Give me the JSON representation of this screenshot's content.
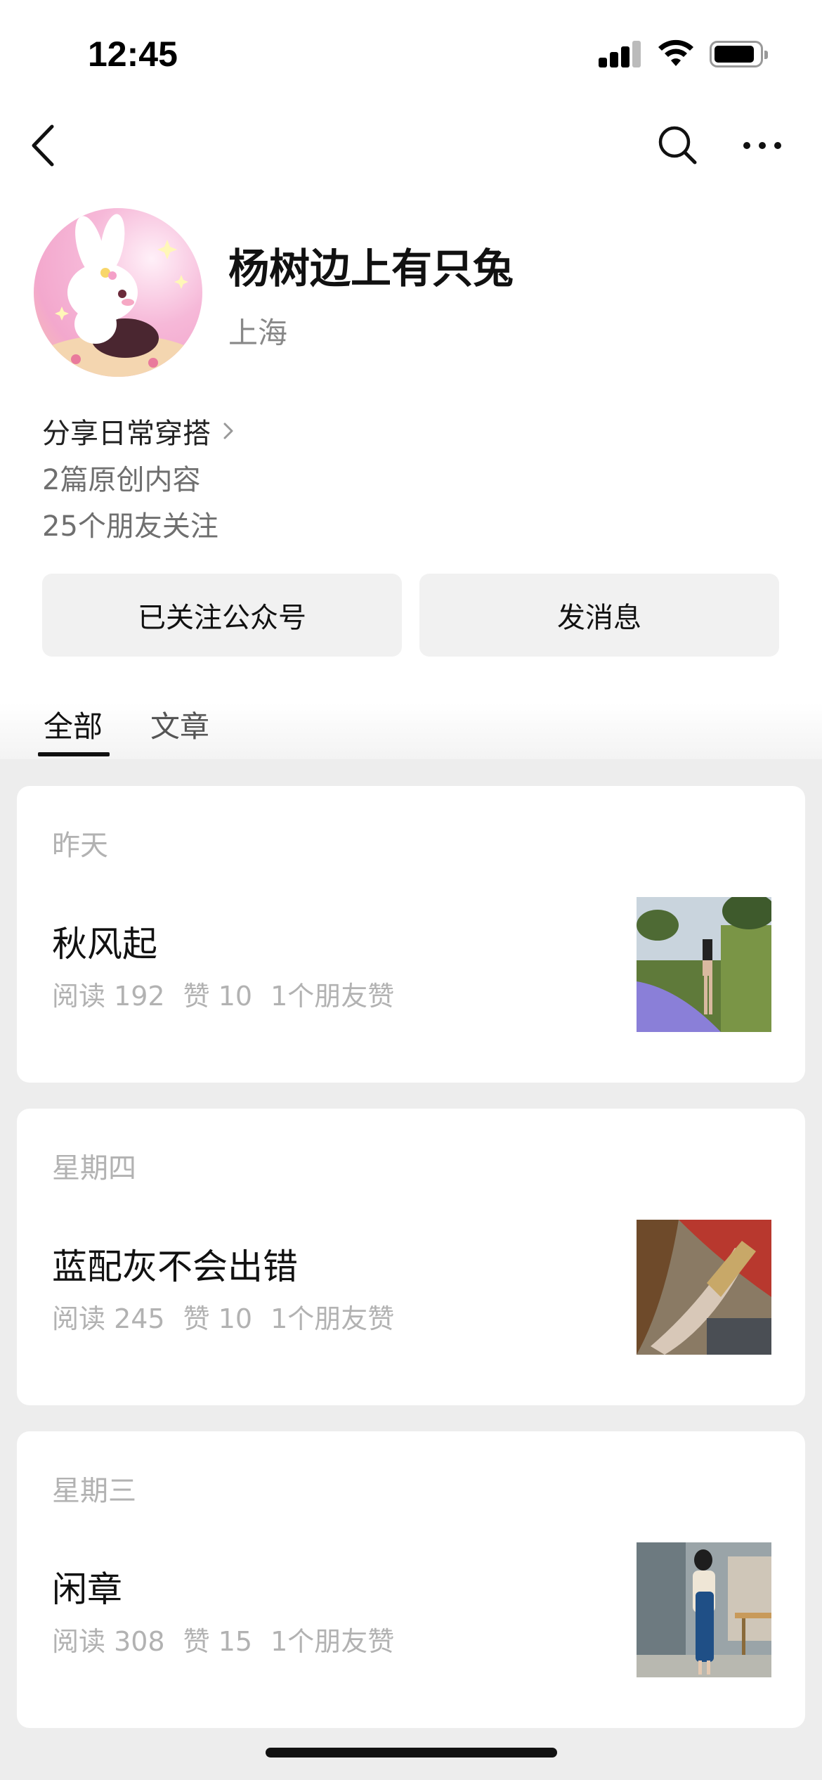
{
  "status_bar": {
    "time": "12:45"
  },
  "profile": {
    "name": "杨树边上有只兔",
    "location": "上海",
    "description": "分享日常穿搭",
    "original_count": "2篇原创内容",
    "friends_following": "25个朋友关注"
  },
  "actions": {
    "followed_label": "已关注公众号",
    "message_label": "发消息"
  },
  "tabs": [
    {
      "label": "全部"
    },
    {
      "label": "文章"
    }
  ],
  "articles": [
    {
      "date": "昨天",
      "title": "秋风起",
      "reads": "阅读 192",
      "likes": "赞 10",
      "friend_likes": "1个朋友赞"
    },
    {
      "date": "星期四",
      "title": "蓝配灰不会出错",
      "reads": "阅读 245",
      "likes": "赞 10",
      "friend_likes": "1个朋友赞"
    },
    {
      "date": "星期三",
      "title": "闲章",
      "reads": "阅读 308",
      "likes": "赞 15",
      "friend_likes": "1个朋友赞"
    }
  ],
  "icons": {
    "back": "chevron-left-icon",
    "search": "search-icon",
    "more": "more-horizontal-icon"
  },
  "colors": {
    "background": "#ededed",
    "card": "#ffffff",
    "button": "#f1f1f1",
    "muted_text": "#b2b2b2"
  }
}
